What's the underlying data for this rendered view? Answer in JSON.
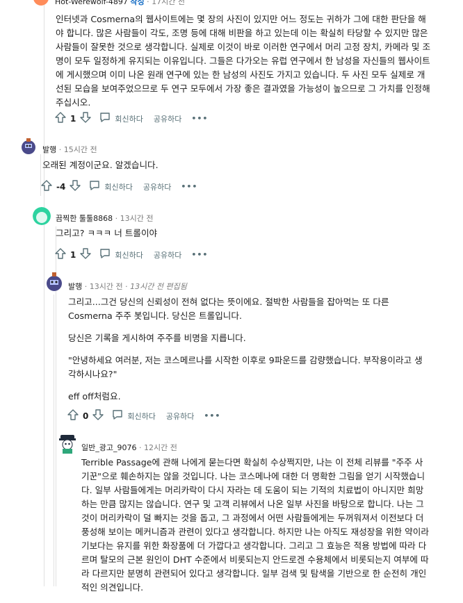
{
  "comments": [
    {
      "author": "Hot-Werewolf-4897",
      "op_badge": "작성",
      "time": "17시간 전",
      "paragraphs": [
        "인터넷과 Cosmerna의 웹사이트에는 몇 장의 사진이 있지만 어느 정도는 귀하가 그에 대한 판단을 해야 합니다. 많은 사람들이 각도, 조명 등에 대해 비판을 하고 있는데 이는 확실히 타당할 수 있지만 많은 사람들이 잘못한 것으로 생각합니다. 실제로 이것이 바로 이러한 연구에서 머리 고정 장치, 카메라 및 조명이 모두 일정하게 유지되는 이유입니다. 그들은 다가오는 유럽 연구에서 한 남성을 자신들의 웹사이트에 게시했으며 이미 나온 원래 연구에 있는 한 남성의 사진도 가지고 있습니다. 두 사진 모두 실제로 개선된 모습을 보여주었으므로 두 연구 모두에서 가장 좋은 결과였을 가능성이 높으므로 그 가치를 인정해 주십시오."
      ],
      "votes": "1",
      "reply": "회신하다",
      "share": "공유하다",
      "more": "•••"
    },
    {
      "author": "발행",
      "time": "15시간 전",
      "paragraphs": [
        "오래된 계정이군요. 알겠습니다."
      ],
      "votes": "-4",
      "reply": "회신하다",
      "share": "공유하다",
      "more": "•••"
    },
    {
      "author": "끔찍한 툴툴8868",
      "time": "13시간 전",
      "paragraphs": [
        "그리고? ㅋㅋㅋ 너 트롤이야"
      ],
      "votes": "1",
      "reply": "회신하다",
      "share": "공유하다",
      "more": "•••"
    },
    {
      "author": "발행",
      "time": "13시간 전",
      "edited": "13시간 전 편집됨",
      "paragraphs": [
        "그리고...그건 당신의 신뢰성이 전혀 없다는 뜻이에요. 절박한 사람들을 잡아먹는 또 다른 Cosmerna 주주 봇입니다. 당신은 트롤입니다.",
        "당신은 기록을 게시하여 주주를 비명을 지릅니다.",
        "\"안녕하세요 여러분, 저는 코스메르나를 시작한 이후로 9파운드를 감량했습니다. 부작용이라고 생각하시나요?\"",
        "eff off처럼요."
      ],
      "votes": "0",
      "reply": "회신하다",
      "share": "공유하다",
      "more": "•••"
    },
    {
      "author": "일반_광고_9076",
      "time": "12시간 전",
      "paragraphs": [
        "Terrible Passage에 관해 나에게 묻는다면 확실히 수상쩍지만, 나는 이 전체 리뷰를 \"주주 사기꾼\"으로 훼손하지는 않을 것입니다. 나는 코스메나에 대한 더 명확한 그림을 얻기 시작했습니다. 일부 사람들에게는 머리카락이 다시 자라는 데 도움이 되는 기적의 치료법이 아니지만 희망하는 만큼 많지는 않습니다. 연구 및 고객 리뷰에서 나온 일부 사진을 바탕으로 합니다. 나는 그것이 머리카락이 덜 빠지는 것을 돕고, 그 과정에서 어떤 사람들에게는 두꺼워져서 이전보다 더 풍성해 보이는 메커니즘과 관련이 있다고 생각합니다. 하지만 나는 아직도 재성장을 위한 약이라기보다는 유지를 위한 화장품에 더 가깝다고 생각합니다. 그리고 그 효능은 적용 방법에 따라 다르며 탈모의 근본 원인이 DHT 수준에서 비롯되는지 안드로겐 수용체에서 비롯되는지 여부에 따라 다르지만 분명히 관련되어 있다고 생각합니다. 일부 검색 및 탐색을 기반으로 한 순전히 개인적인 의견입니다."
      ]
    }
  ]
}
